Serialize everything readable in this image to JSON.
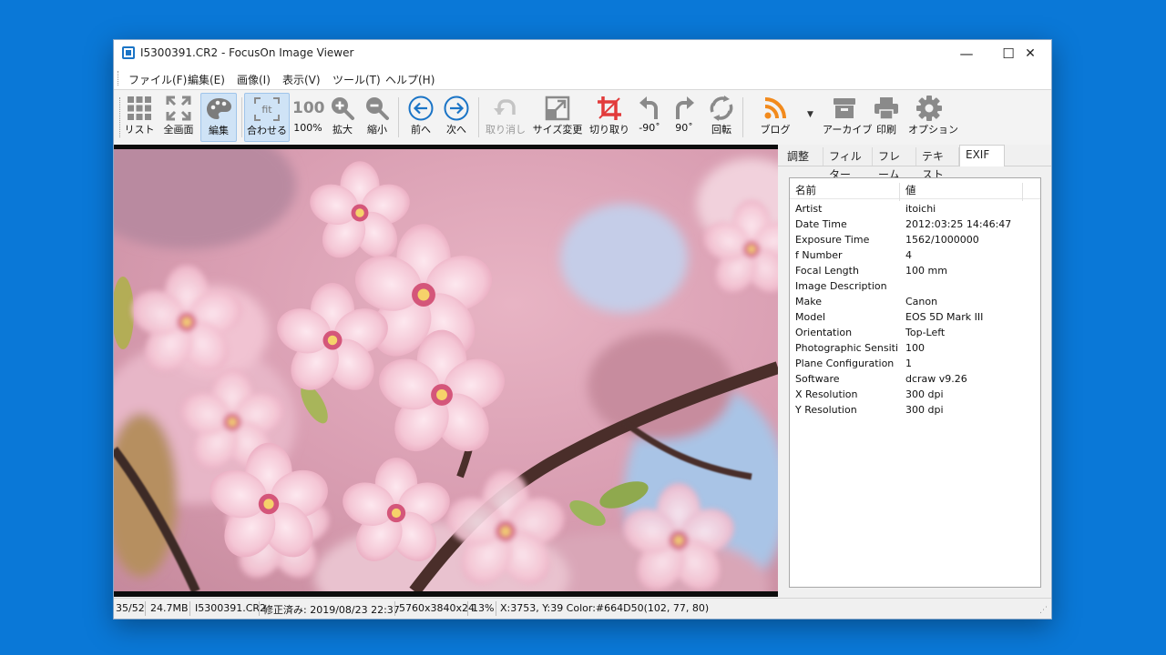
{
  "window": {
    "title": "I5300391.CR2 - FocusOn Image Viewer",
    "minimize": "—",
    "maximize": "☐",
    "close": "✕"
  },
  "menu": [
    "ファイル(F)",
    "編集(E)",
    "画像(I)",
    "表示(V)",
    "ツール(T)",
    "ヘルプ(H)"
  ],
  "toolbar": {
    "list": "リスト",
    "fullscreen": "全画面",
    "edit": "編集",
    "fit": "合わせる",
    "fit_icon_text": "fit",
    "zoom100": "100%",
    "zoom100_icon_text": "100",
    "zoom_in": "拡大",
    "zoom_out": "縮小",
    "prev": "前へ",
    "next": "次へ",
    "undo": "取り消し",
    "resize": "サイズ変更",
    "crop": "切り取り",
    "rotate_left": "-90˚",
    "rotate_right": "90˚",
    "rotate": "回転",
    "blog": "ブログ",
    "archive": "アーカイブ",
    "print": "印刷",
    "options": "オプション"
  },
  "panel": {
    "tabs": [
      "調整",
      "フィルター",
      "フレーム",
      "テキスト",
      "EXIF"
    ],
    "active_tab": "EXIF",
    "exif": {
      "col_name": "名前",
      "col_value": "値",
      "rows": [
        {
          "name": "Artist",
          "value": "itoichi"
        },
        {
          "name": "Date Time",
          "value": "2012:03:25 14:46:47"
        },
        {
          "name": "Exposure Time",
          "value": "1562/1000000"
        },
        {
          "name": "f Number",
          "value": "4"
        },
        {
          "name": "Focal Length",
          "value": "100 mm"
        },
        {
          "name": "Image Description",
          "value": ""
        },
        {
          "name": "Make",
          "value": "Canon"
        },
        {
          "name": "Model",
          "value": "EOS 5D Mark III"
        },
        {
          "name": "Orientation",
          "value": "Top-Left"
        },
        {
          "name": "Photographic Sensiti...",
          "value": "100"
        },
        {
          "name": "Plane Configuration",
          "value": "1"
        },
        {
          "name": "Software",
          "value": "dcraw v9.26"
        },
        {
          "name": "X Resolution",
          "value": "300 dpi"
        },
        {
          "name": "Y Resolution",
          "value": "300 dpi"
        }
      ]
    }
  },
  "status": {
    "index": "35/52",
    "size": "24.7MB",
    "filename": "I5300391.CR2",
    "modified": "修正済み: 2019/08/23 22:37",
    "dimensions": "5760x3840x24",
    "zoom": "13%",
    "pixel_info": "X:3753, Y:39 Color:#664D50(102, 77, 80)"
  },
  "colors": {
    "desktop": "#0a78d7",
    "accent": "#1a74c6",
    "blossom": "#f4c4d4",
    "branch": "#4a2e2a"
  }
}
